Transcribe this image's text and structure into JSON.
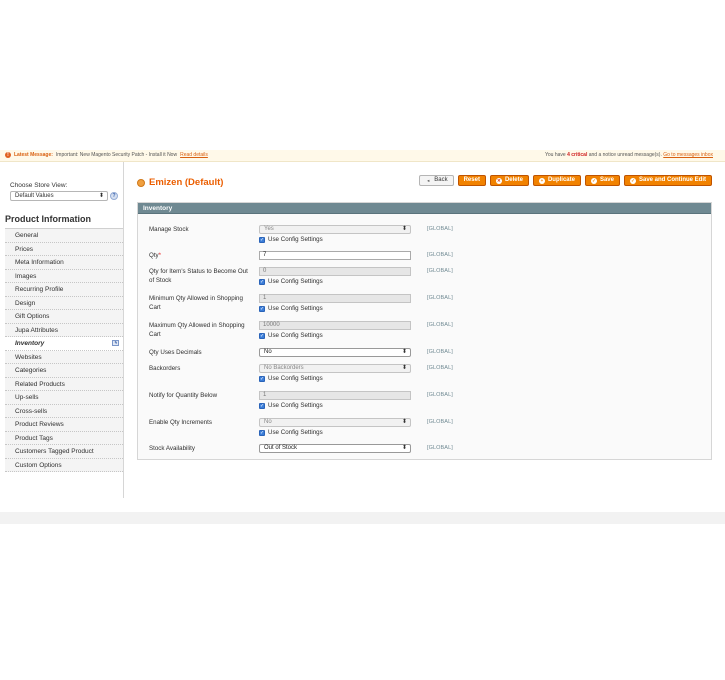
{
  "notice": {
    "icon": "!",
    "label": "Latest Message:",
    "text": "Important: New Magento Security Patch - Install it Now",
    "link": "Read details",
    "right_prefix": "You have",
    "critical_count": "4 critical",
    "right_suffix": "and a notice unread message(s).",
    "right_link": "Go to messages inbox"
  },
  "sidebar": {
    "store_label": "Choose Store View:",
    "store_value": "Default Values",
    "title": "Product Information",
    "items": [
      {
        "label": "General",
        "active": false
      },
      {
        "label": "Prices",
        "active": false
      },
      {
        "label": "Meta Information",
        "active": false
      },
      {
        "label": "Images",
        "active": false
      },
      {
        "label": "Recurring Profile",
        "active": false
      },
      {
        "label": "Design",
        "active": false
      },
      {
        "label": "Gift Options",
        "active": false
      },
      {
        "label": "Jupa Attributes",
        "active": false
      },
      {
        "label": "Inventory",
        "active": true
      },
      {
        "label": "Websites",
        "active": false
      },
      {
        "label": "Categories",
        "active": false
      },
      {
        "label": "Related Products",
        "active": false
      },
      {
        "label": "Up-sells",
        "active": false
      },
      {
        "label": "Cross-sells",
        "active": false
      },
      {
        "label": "Product Reviews",
        "active": false
      },
      {
        "label": "Product Tags",
        "active": false
      },
      {
        "label": "Customers Tagged Product",
        "active": false
      },
      {
        "label": "Custom Options",
        "active": false
      }
    ]
  },
  "header": {
    "title": "Emizen (Default)",
    "buttons": {
      "back": "Back",
      "reset": "Reset",
      "delete": "Delete",
      "duplicate": "Duplicate",
      "save": "Save",
      "save_continue": "Save and Continue Edit"
    }
  },
  "inventory": {
    "section_title": "Inventory",
    "use_config": "Use Config Settings",
    "scope": "[GLOBAL]",
    "manage_stock": {
      "label": "Manage Stock",
      "value": "Yes"
    },
    "qty": {
      "label": "Qty",
      "required": "*",
      "value": "7"
    },
    "out_of_stock": {
      "label": "Qty for Item's Status to Become Out of Stock",
      "value": "0"
    },
    "min_qty": {
      "label": "Minimum Qty Allowed in Shopping Cart",
      "value": "1"
    },
    "max_qty": {
      "label": "Maximum Qty Allowed in Shopping Cart",
      "value": "10000"
    },
    "decimals": {
      "label": "Qty Uses Decimals",
      "value": "No"
    },
    "backorders": {
      "label": "Backorders",
      "value": "No Backorders"
    },
    "notify": {
      "label": "Notify for Quantity Below",
      "value": "1"
    },
    "increments": {
      "label": "Enable Qty Increments",
      "value": "No"
    },
    "availability": {
      "label": "Stock Availability",
      "value": "Out of Stock"
    }
  },
  "colors": {
    "accent": "#eb5e00",
    "button": "#f18200",
    "section_header": "#6f8992",
    "checkbox": "#3b7dd8"
  }
}
